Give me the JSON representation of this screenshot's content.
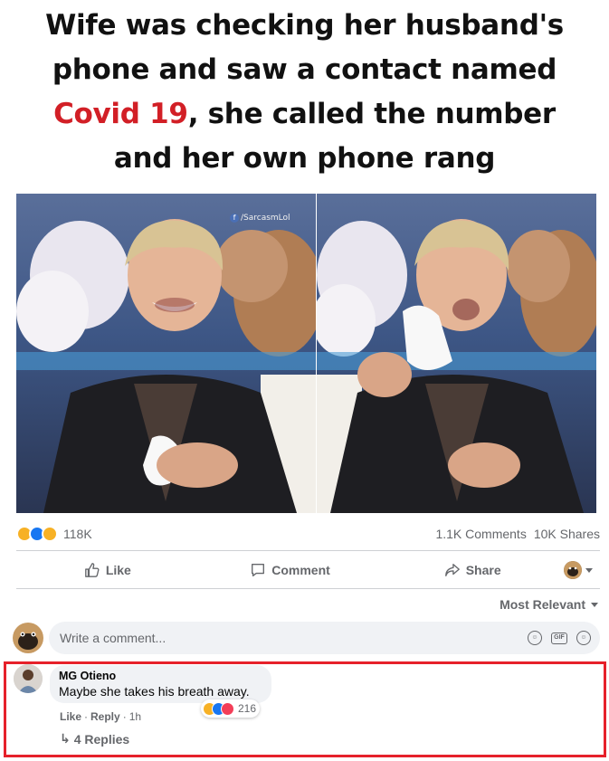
{
  "meme": {
    "title_part1": "Wife was checking her husband's phone and saw a contact named",
    "title_highlight": "Covid 19",
    "title_part2": ", she called the number and her own phone rang",
    "watermark": "/SarcasmLol"
  },
  "post_stats": {
    "reactions_count": "118K",
    "comments": "1.1K Comments",
    "shares": "10K Shares"
  },
  "actions": {
    "like": "Like",
    "comment": "Comment",
    "share": "Share"
  },
  "sort_label": "Most Relevant",
  "comment_input": {
    "placeholder": "Write a comment..."
  },
  "comment": {
    "author": "MG Otieno",
    "text": "Maybe she takes his breath away.",
    "reaction_count": "216",
    "like": "Like",
    "reply": "Reply",
    "time": "1h",
    "replies": "4 Replies"
  },
  "colors": {
    "highlight_border": "#e6212a",
    "title_red": "#d21f26",
    "fb_blue": "#1877f2"
  }
}
